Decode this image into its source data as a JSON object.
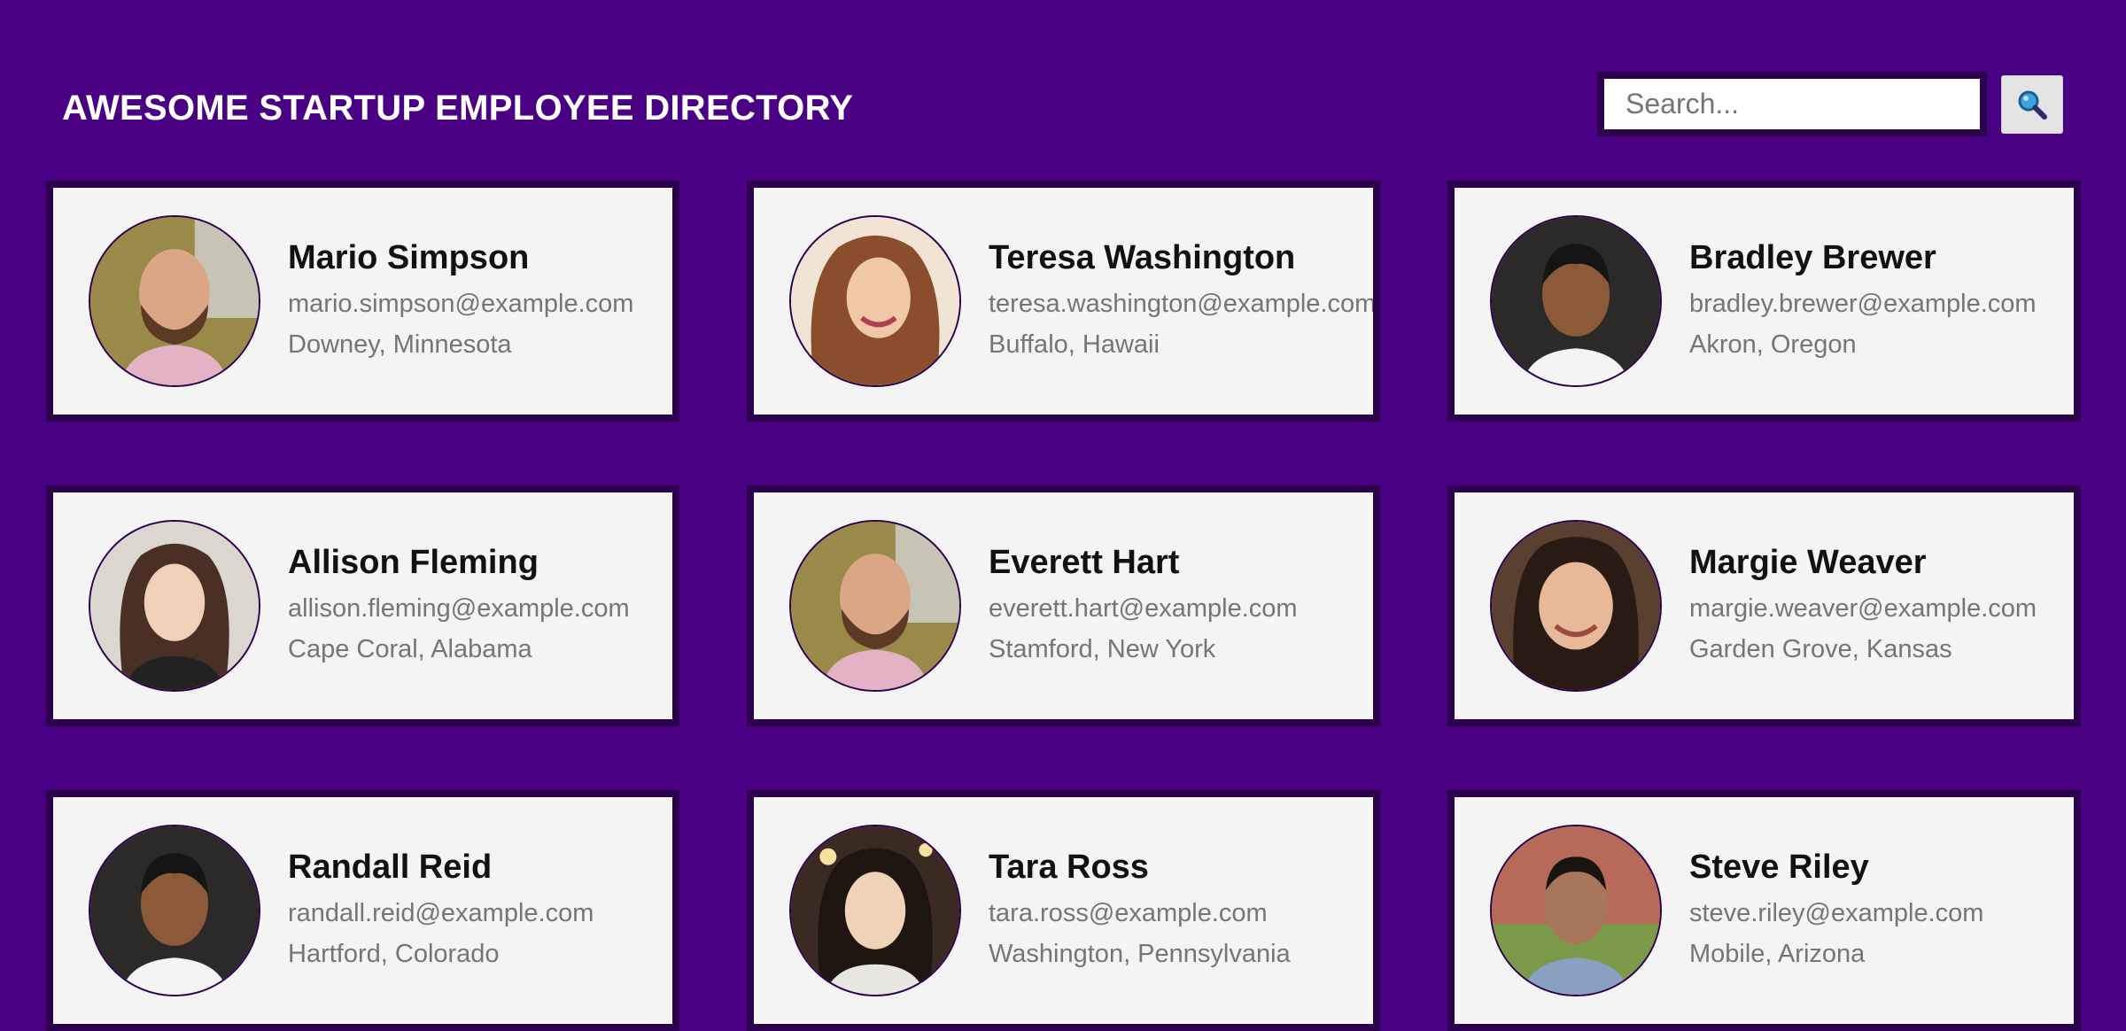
{
  "header": {
    "title": "AWESOME STARTUP EMPLOYEE DIRECTORY"
  },
  "search": {
    "placeholder": "Search...",
    "value": "",
    "button_icon": "magnifier-icon"
  },
  "colors": {
    "background": "#4a0082",
    "card_border": "#2c004c",
    "card_background": "#f4f4f4",
    "name_text": "#111111",
    "detail_text": "#757575"
  },
  "employees": [
    {
      "name": "Mario Simpson",
      "email": "mario.simpson@example.com",
      "location": "Downey, Minnesota"
    },
    {
      "name": "Teresa Washington",
      "email": "teresa.washington@example.com",
      "location": "Buffalo, Hawaii"
    },
    {
      "name": "Bradley Brewer",
      "email": "bradley.brewer@example.com",
      "location": "Akron, Oregon"
    },
    {
      "name": "Allison Fleming",
      "email": "allison.fleming@example.com",
      "location": "Cape Coral, Alabama"
    },
    {
      "name": "Everett Hart",
      "email": "everett.hart@example.com",
      "location": "Stamford, New York"
    },
    {
      "name": "Margie Weaver",
      "email": "margie.weaver@example.com",
      "location": "Garden Grove, Kansas"
    },
    {
      "name": "Randall Reid",
      "email": "randall.reid@example.com",
      "location": "Hartford, Colorado"
    },
    {
      "name": "Tara Ross",
      "email": "tara.ross@example.com",
      "location": "Washington, Pennsylvania"
    },
    {
      "name": "Steve Riley",
      "email": "steve.riley@example.com",
      "location": "Mobile, Arizona"
    }
  ]
}
